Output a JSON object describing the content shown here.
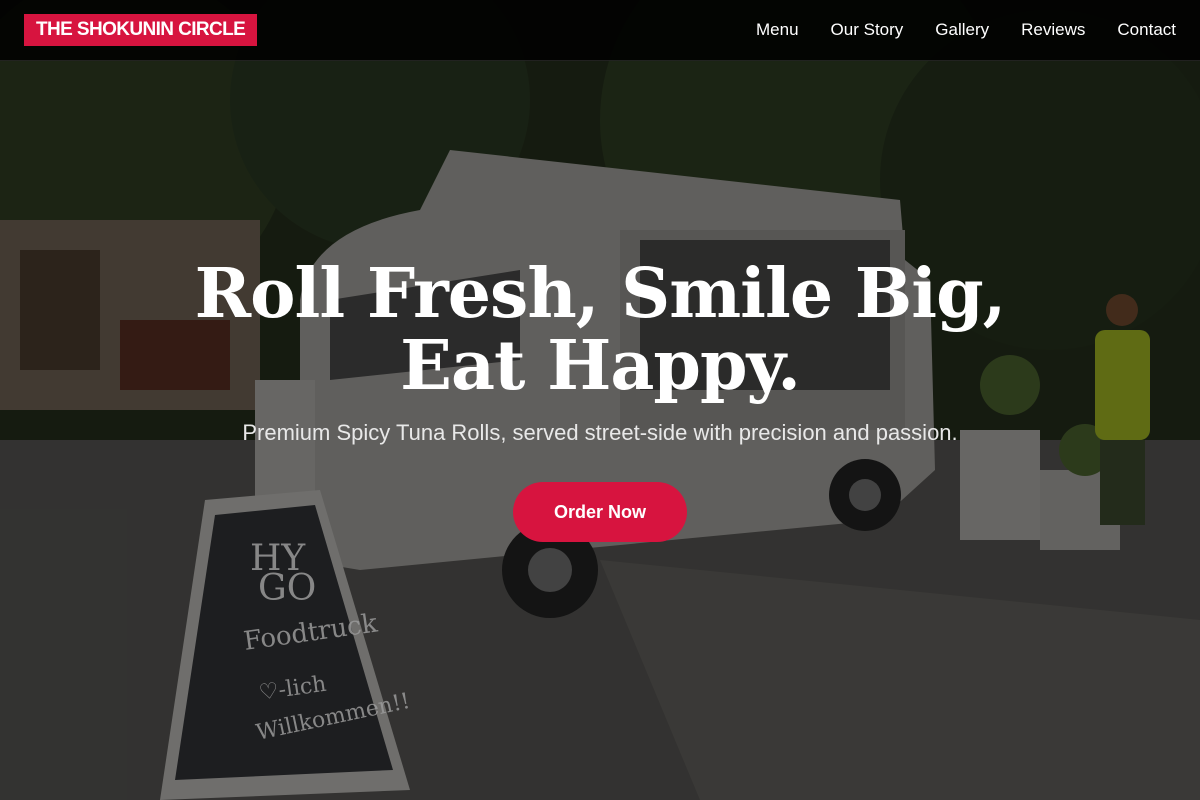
{
  "brand": {
    "name": "THE SHOKUNIN CIRCLE",
    "accent_color": "#d7143f"
  },
  "nav": {
    "items": [
      {
        "label": "Menu"
      },
      {
        "label": "Our Story"
      },
      {
        "label": "Gallery"
      },
      {
        "label": "Reviews"
      },
      {
        "label": "Contact"
      }
    ]
  },
  "hero": {
    "title": "Roll Fresh, Smile Big, Eat Happy.",
    "subtitle": "Premium Spicy Tuna Rolls, served street-side with precision and passion.",
    "cta_label": "Order Now",
    "sign_text": {
      "line1": "HY",
      "line2": "GO",
      "line3": "Foodtruck",
      "line4": "♡-lich",
      "line5": "Willkommen!!"
    }
  }
}
